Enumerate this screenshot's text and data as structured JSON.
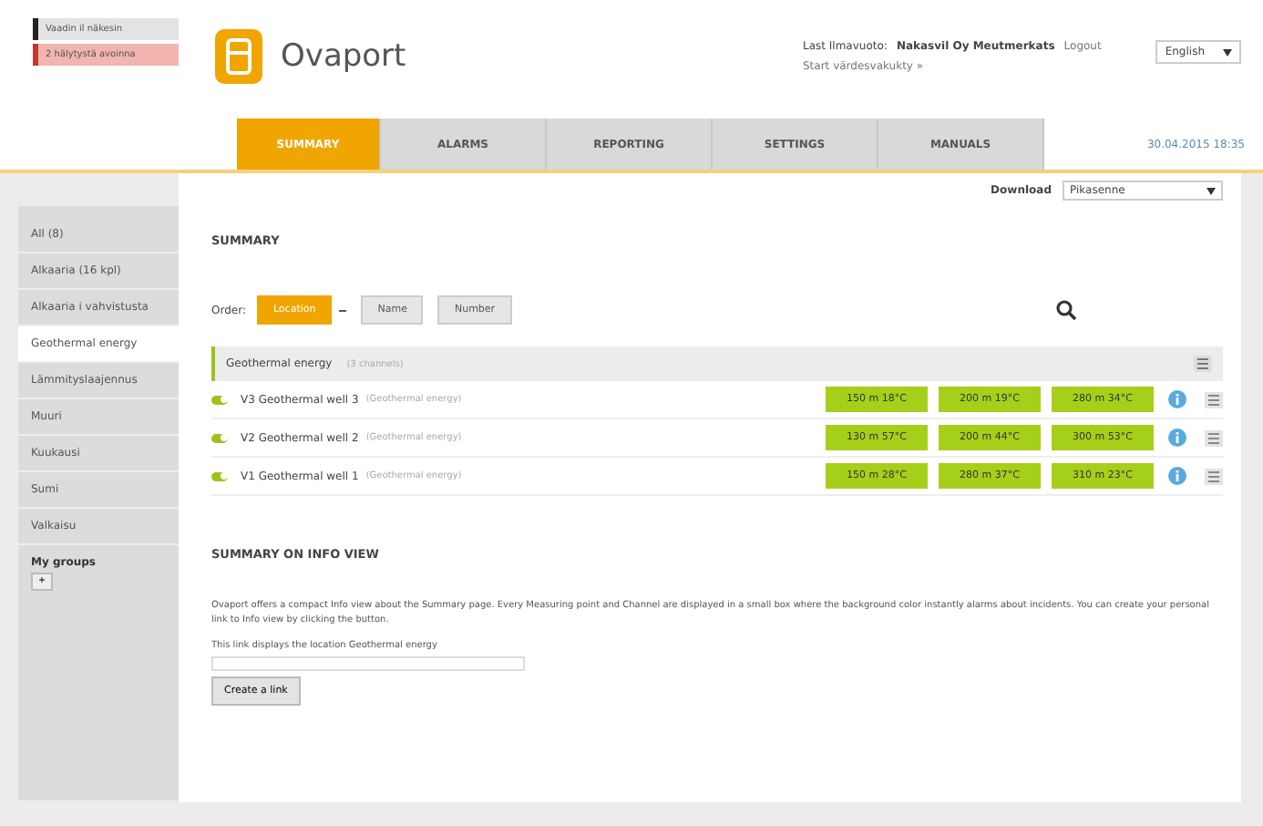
{
  "alerts": [
    {
      "text": "Vaadin il näkesin",
      "color": "#222222"
    },
    {
      "text": "2 hälytystä avoinna",
      "color": "#c0392b"
    }
  ],
  "logo": {
    "title": "Ovaport"
  },
  "user": {
    "label": "Last Ilmavuoto:",
    "company": "Nakasvil Oy Meutmerkats",
    "logout": "Logout",
    "start": "Start värdesvakukty »"
  },
  "language": {
    "value": "English"
  },
  "tabs": [
    {
      "label": "SUMMARY",
      "selected": true
    },
    {
      "label": "ALARMS",
      "selected": false
    },
    {
      "label": "REPORTING",
      "selected": false
    },
    {
      "label": "SETTINGS",
      "selected": false
    },
    {
      "label": "MANUALS",
      "selected": false
    }
  ],
  "datetime": "30.04.2015 18:35",
  "download": {
    "label": "Download",
    "value": "Pikasenne"
  },
  "sidebar": {
    "items": [
      {
        "label": "All (8)",
        "selected": false
      },
      {
        "label": "Alkaaria (16 kpl)",
        "selected": false
      },
      {
        "label": "Alkaaria i vahvistusta",
        "selected": false
      },
      {
        "label": "Geothermal energy",
        "selected": true
      },
      {
        "label": "Lämmityslaajennus",
        "selected": false
      },
      {
        "label": "Muuri",
        "selected": false
      },
      {
        "label": "Kuukausi",
        "selected": false
      },
      {
        "label": "Sumi",
        "selected": false
      },
      {
        "label": "Valkaisu",
        "selected": false
      }
    ],
    "groups_title": "My groups",
    "add": "+"
  },
  "summary": {
    "title": "SUMMARY",
    "order_label": "Order:",
    "order_buttons": [
      {
        "label": "Location",
        "selected": true
      },
      {
        "label": "Name",
        "selected": false
      },
      {
        "label": "Number",
        "selected": false
      }
    ],
    "group": {
      "name": "Geothermal energy",
      "count": "(3 channels)"
    },
    "rows": [
      {
        "on": true,
        "name": "V3 Geothermal well 3",
        "location": "(Geothermal energy)",
        "values": [
          "150 m 18°C",
          "200 m 19°C",
          "280 m 34°C"
        ]
      },
      {
        "on": true,
        "name": "V2 Geothermal well 2",
        "location": "(Geothermal energy)",
        "values": [
          "130 m 57°C",
          "200 m 44°C",
          "300 m 53°C"
        ]
      },
      {
        "on": true,
        "name": "V1 Geothermal well 1",
        "location": "(Geothermal energy)",
        "values": [
          "150 m 28°C",
          "280 m 37°C",
          "310 m 23°C"
        ]
      }
    ]
  },
  "info": {
    "title": "SUMMARY ON INFO VIEW",
    "paragraph": "Ovaport offers a compact Info view about the Summary page. Every Measuring point and Channel are displayed in a small box where the background color instantly alarms about incidents. You can create your personal link to Info view by clicking the button.",
    "link_text": "This link displays the location Geothermal energy",
    "button": "Create a link"
  }
}
